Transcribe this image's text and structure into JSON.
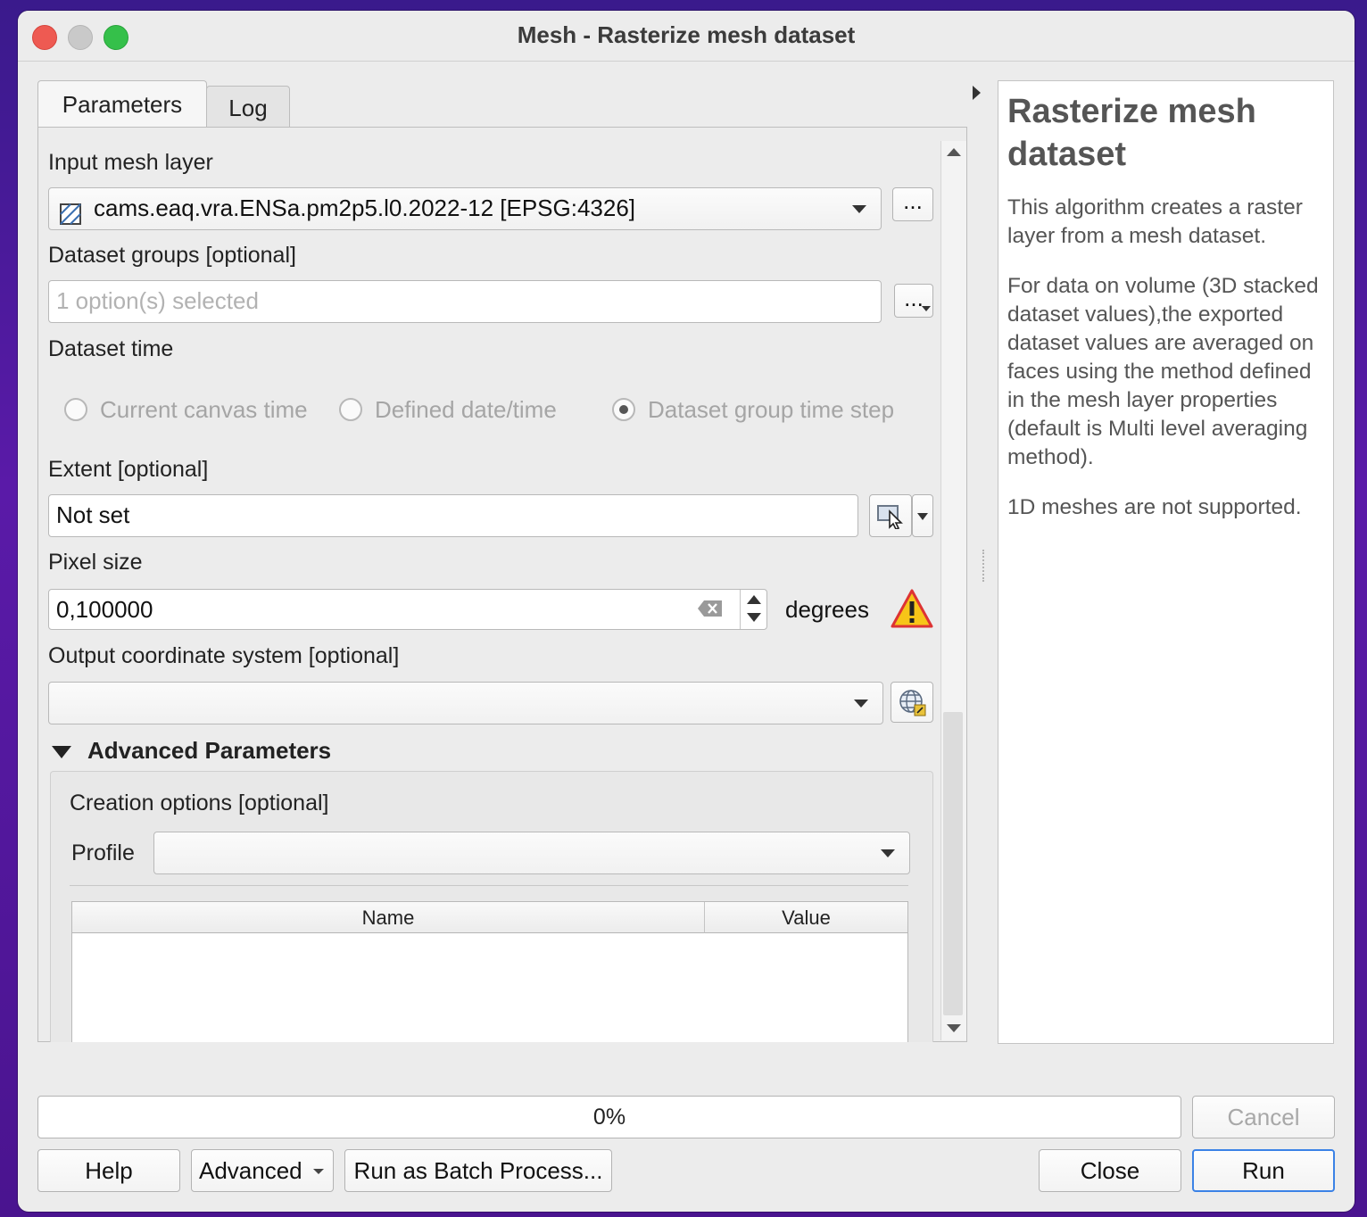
{
  "window": {
    "title": "Mesh - Rasterize mesh dataset"
  },
  "tabs": [
    {
      "label": "Parameters"
    },
    {
      "label": "Log"
    }
  ],
  "params": {
    "input_mesh_layer": {
      "label": "Input mesh layer",
      "value": "cams.eaq.vra.ENSa.pm2p5.l0.2022-12 [EPSG:4326]",
      "browse": "..."
    },
    "dataset_groups": {
      "label": "Dataset groups [optional]",
      "placeholder": "1 option(s) selected",
      "browse": "..."
    },
    "dataset_time": {
      "label": "Dataset time",
      "options": [
        "Current canvas time",
        "Defined date/time",
        "Dataset group time step"
      ],
      "selected": "Dataset group time step"
    },
    "extent": {
      "label": "Extent [optional]",
      "value": "Not set"
    },
    "pixel_size": {
      "label": "Pixel size",
      "value": "0,100000",
      "unit": "degrees"
    },
    "output_crs": {
      "label": "Output coordinate system [optional]",
      "value": ""
    },
    "advanced": {
      "label": "Advanced Parameters",
      "creation_options": {
        "label": "Creation options [optional]",
        "profile_label": "Profile",
        "profile_value": "",
        "columns": [
          "Name",
          "Value"
        ]
      }
    }
  },
  "help": {
    "title": "Rasterize mesh dataset",
    "paragraphs": [
      "This algorithm creates a raster layer from a mesh dataset.",
      "For data on volume (3D stacked dataset values),the exported dataset values are averaged on faces using the method defined in the mesh layer properties (default is Multi level averaging method).",
      "1D meshes are not supported."
    ]
  },
  "progress": {
    "label": "0%",
    "value": 0
  },
  "buttons": {
    "cancel": "Cancel",
    "help": "Help",
    "advanced": "Advanced",
    "batch": "Run as Batch Process...",
    "close": "Close",
    "run": "Run"
  },
  "colors": {
    "close_light": "#ee5a52",
    "minimize_light": "#c9c9c9",
    "zoom_light": "#35c04a",
    "run_border": "#3b82e6",
    "warning": "#f7c518"
  }
}
